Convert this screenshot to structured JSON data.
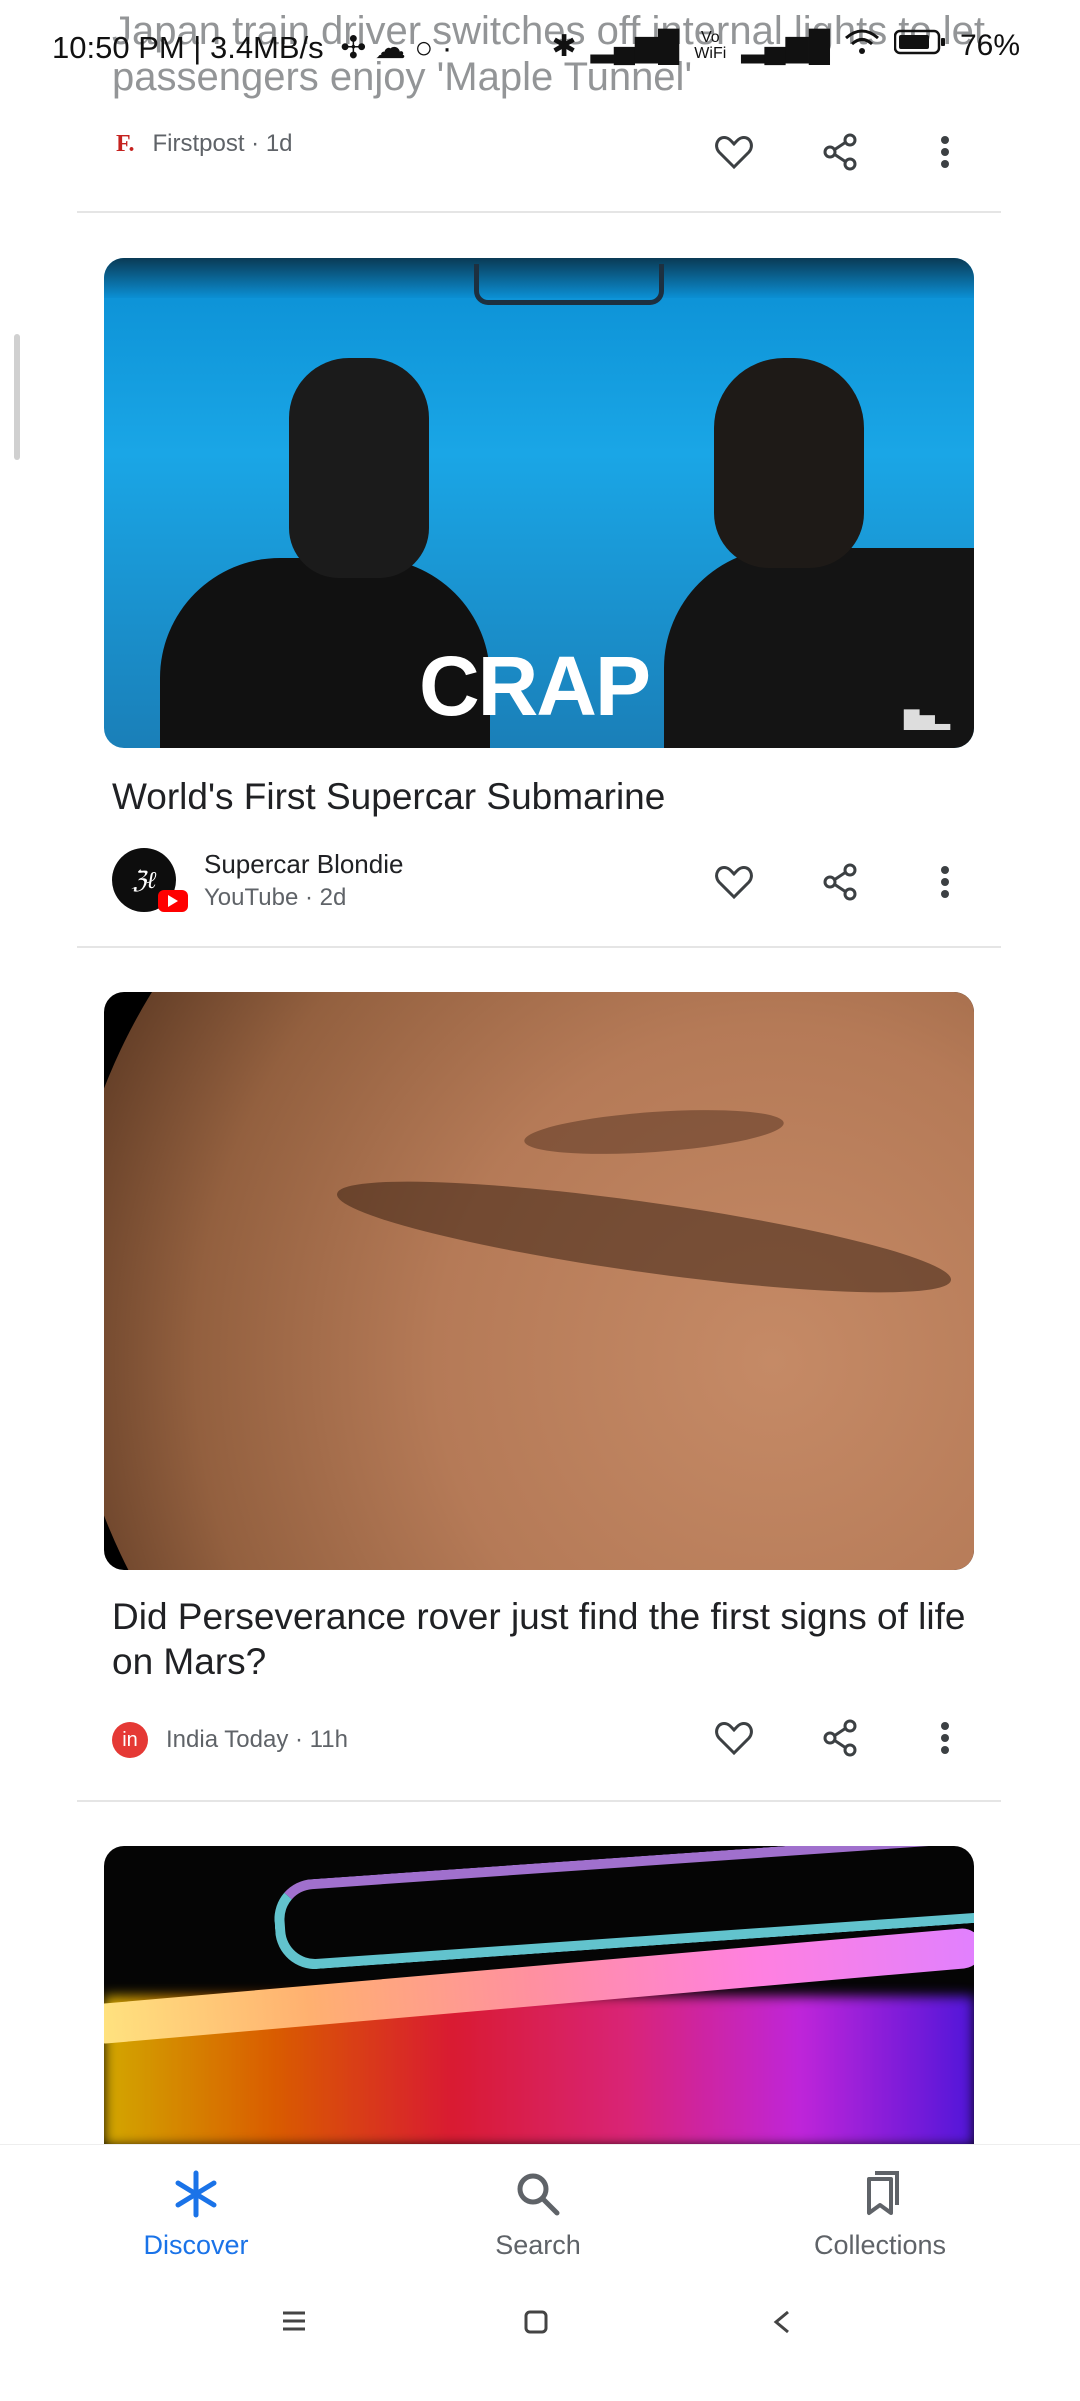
{
  "status_bar": {
    "time_speed": "10:50 PM | 3.4MB/s",
    "wifi_label": "Vo WiFi",
    "battery": "76%"
  },
  "cards": [
    {
      "headline": "Japan train driver switches off internal lights to let passengers enjoy 'Maple Tunnel'",
      "source": "Firstpost",
      "age": "1d",
      "source_logo": "F."
    },
    {
      "image_overlay_text": "CRAP",
      "headline": "World's First Supercar Submarine",
      "channel": "Supercar Blondie",
      "source": "YouTube",
      "age": "2d"
    },
    {
      "headline": "Did Perseverance rover just find the first signs of life on Mars?",
      "source": "India Today",
      "age": "11h",
      "source_logo": "in"
    }
  ],
  "bottom_nav": {
    "items": [
      {
        "label": "Discover",
        "icon": "discover-asterisk-icon",
        "active": true
      },
      {
        "label": "Search",
        "icon": "search-icon",
        "active": false
      },
      {
        "label": "Collections",
        "icon": "collections-icon",
        "active": false
      }
    ]
  },
  "colors": {
    "accent": "#1a73e8",
    "text": "#202124",
    "muted": "#5f6368"
  }
}
